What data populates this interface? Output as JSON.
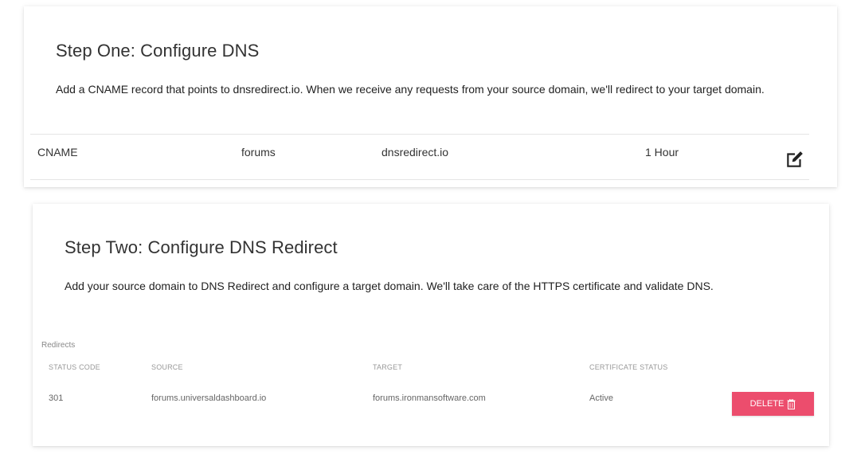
{
  "step_one": {
    "title": "Step One: Configure DNS",
    "description": "Add a CNAME record that points to dnsredirect.io. When we receive any requests from your source domain, we'll redirect to your target domain.",
    "record": {
      "type": "CNAME",
      "host": "forums",
      "value": "dnsredirect.io",
      "ttl": "1 Hour"
    },
    "edit_icon": "edit-icon"
  },
  "step_two": {
    "title": "Step Two: Configure DNS Redirect",
    "description": "Add your source domain to DNS Redirect and configure a target domain. We'll take care of the HTTPS certificate and validate DNS.",
    "redirects_label": "Redirects",
    "columns": {
      "status_code": "STATUS CODE",
      "source": "SOURCE",
      "target": "TARGET",
      "certificate_status": "CERTIFICATE STATUS"
    },
    "rows": [
      {
        "status_code": "301",
        "source": "forums.universaldashboard.io",
        "target": "forums.ironmansoftware.com",
        "certificate_status": "Active",
        "delete_label": "DELETE"
      }
    ]
  },
  "colors": {
    "delete_button": "#ec4d6d",
    "text": "#333333"
  }
}
